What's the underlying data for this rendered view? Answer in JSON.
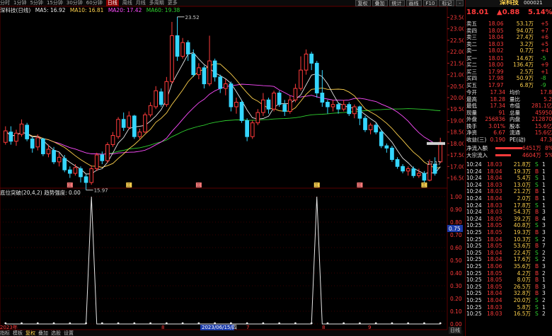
{
  "toolbar": {
    "stock_short": "深科技(日线)",
    "periods": [
      "分时",
      "1分钟",
      "5分钟",
      "15分钟",
      "30分钟",
      "60分钟",
      "日线",
      "周线",
      "月线",
      "多周期",
      "更多"
    ],
    "active_period": "日线",
    "tools": [
      "复权",
      "叠加",
      "统计",
      "画线",
      "F10",
      "标记",
      "-"
    ]
  },
  "ma_legend": {
    "ma5": "MA5: 16.92",
    "ma10": "MA10: 16.81",
    "ma20": "MA20: 17.42",
    "ma60": "MA60: 19.38"
  },
  "indicator_legend": {
    "name": "底位突破(20,4,2)",
    "trend_label": "趋势强度:",
    "trend_value": "0.00"
  },
  "colors": {
    "up": "#ff3b3b",
    "down": "#35d6ff",
    "ma5": "#e8e8e8",
    "ma10": "#ffd24d",
    "ma20": "#ff4dff",
    "ma60": "#2fcf2f"
  },
  "chart_data": {
    "type": "candlestick",
    "y_ticks": [
      "23.50",
      "23.00",
      "22.50",
      "22.00",
      "21.50",
      "21.00",
      "20.50",
      "20.00",
      "19.50",
      "19.00",
      "18.50",
      "18.00",
      "17.50",
      "17.00",
      "16.50"
    ],
    "ylim": [
      16.3,
      23.7
    ],
    "ind_ticks": [
      "1.00",
      "0.90",
      "0.80",
      "0.70",
      "0.60",
      "0.50",
      "0.40",
      "0.30",
      "0.20",
      "0.10",
      "0.00"
    ],
    "ind_ylim": [
      0,
      1.0
    ],
    "high_label": "23.52",
    "low_label": "15.97",
    "last_label": "17.17",
    "marker_value": "0.75",
    "candles": [
      {
        "o": 18.05,
        "c": 18.55,
        "h": 18.75,
        "l": 17.95
      },
      {
        "o": 18.5,
        "c": 18.1,
        "h": 18.75,
        "l": 17.95
      },
      {
        "o": 18.1,
        "c": 18.45,
        "h": 18.6,
        "l": 17.9
      },
      {
        "o": 18.4,
        "c": 18.85,
        "h": 19.05,
        "l": 18.3
      },
      {
        "o": 18.8,
        "c": 18.2,
        "h": 18.9,
        "l": 18.1
      },
      {
        "o": 18.2,
        "c": 17.8,
        "h": 18.3,
        "l": 17.6
      },
      {
        "o": 17.85,
        "c": 18.25,
        "h": 18.4,
        "l": 17.7
      },
      {
        "o": 18.2,
        "c": 17.55,
        "h": 18.25,
        "l": 17.45
      },
      {
        "o": 17.55,
        "c": 17.75,
        "h": 17.95,
        "l": 17.4
      },
      {
        "o": 17.7,
        "c": 17.2,
        "h": 17.85,
        "l": 17.1
      },
      {
        "o": 17.2,
        "c": 17.4,
        "h": 17.6,
        "l": 17.0
      },
      {
        "o": 17.35,
        "c": 16.85,
        "h": 17.5,
        "l": 16.75
      },
      {
        "o": 16.85,
        "c": 16.7,
        "h": 17.0,
        "l": 16.5
      },
      {
        "o": 16.7,
        "c": 16.95,
        "h": 17.1,
        "l": 16.6
      },
      {
        "o": 16.9,
        "c": 16.55,
        "h": 17.0,
        "l": 16.3
      },
      {
        "o": 16.55,
        "c": 16.3,
        "h": 16.65,
        "l": 15.97
      },
      {
        "o": 16.3,
        "c": 16.9,
        "h": 17.05,
        "l": 16.2
      },
      {
        "o": 16.9,
        "c": 17.5,
        "h": 17.6,
        "l": 16.8
      },
      {
        "o": 17.5,
        "c": 17.25,
        "h": 17.65,
        "l": 17.1
      },
      {
        "o": 17.25,
        "c": 17.95,
        "h": 18.05,
        "l": 17.15
      },
      {
        "o": 17.95,
        "c": 18.35,
        "h": 18.5,
        "l": 17.85
      },
      {
        "o": 18.3,
        "c": 19.05,
        "h": 19.15,
        "l": 18.2
      },
      {
        "o": 19.05,
        "c": 18.7,
        "h": 19.35,
        "l": 18.55
      },
      {
        "o": 18.7,
        "c": 19.2,
        "h": 19.4,
        "l": 18.6
      },
      {
        "o": 19.2,
        "c": 18.3,
        "h": 19.25,
        "l": 18.2
      },
      {
        "o": 18.3,
        "c": 18.5,
        "h": 18.65,
        "l": 18.2
      },
      {
        "o": 18.5,
        "c": 19.25,
        "h": 19.35,
        "l": 18.45
      },
      {
        "o": 19.25,
        "c": 19.65,
        "h": 19.8,
        "l": 19.15
      },
      {
        "o": 19.6,
        "c": 20.3,
        "h": 20.5,
        "l": 19.5
      },
      {
        "o": 20.25,
        "c": 19.7,
        "h": 20.4,
        "l": 19.6
      },
      {
        "o": 19.7,
        "c": 20.7,
        "h": 20.9,
        "l": 19.6
      },
      {
        "o": 20.7,
        "c": 22.7,
        "h": 23.3,
        "l": 20.6
      },
      {
        "o": 22.7,
        "c": 21.8,
        "h": 23.52,
        "l": 21.6
      },
      {
        "o": 21.8,
        "c": 22.4,
        "h": 22.6,
        "l": 21.7
      },
      {
        "o": 22.4,
        "c": 21.9,
        "h": 22.5,
        "l": 21.6
      },
      {
        "o": 21.9,
        "c": 21.0,
        "h": 22.1,
        "l": 20.9
      },
      {
        "o": 21.0,
        "c": 21.3,
        "h": 21.5,
        "l": 20.8
      },
      {
        "o": 21.3,
        "c": 20.6,
        "h": 21.4,
        "l": 20.4
      },
      {
        "o": 20.6,
        "c": 21.6,
        "h": 22.7,
        "l": 20.5
      },
      {
        "o": 21.6,
        "c": 20.9,
        "h": 21.7,
        "l": 20.7
      },
      {
        "o": 20.9,
        "c": 20.4,
        "h": 21.0,
        "l": 20.2
      },
      {
        "o": 20.4,
        "c": 20.6,
        "h": 20.8,
        "l": 20.1
      },
      {
        "o": 20.6,
        "c": 19.6,
        "h": 20.7,
        "l": 19.4
      },
      {
        "o": 19.6,
        "c": 19.8,
        "h": 20.0,
        "l": 19.3
      },
      {
        "o": 19.8,
        "c": 19.0,
        "h": 19.9,
        "l": 18.9
      },
      {
        "o": 19.0,
        "c": 18.3,
        "h": 19.1,
        "l": 18.1
      },
      {
        "o": 18.3,
        "c": 18.9,
        "h": 19.0,
        "l": 18.2
      },
      {
        "o": 18.9,
        "c": 19.35,
        "h": 19.5,
        "l": 18.8
      },
      {
        "o": 19.35,
        "c": 19.9,
        "h": 20.2,
        "l": 19.2
      },
      {
        "o": 19.9,
        "c": 19.5,
        "h": 20.0,
        "l": 19.3
      },
      {
        "o": 19.5,
        "c": 20.2,
        "h": 20.3,
        "l": 19.4
      },
      {
        "o": 20.2,
        "c": 19.7,
        "h": 20.3,
        "l": 19.6
      },
      {
        "o": 19.7,
        "c": 19.4,
        "h": 19.9,
        "l": 19.2
      },
      {
        "o": 19.4,
        "c": 19.9,
        "h": 20.1,
        "l": 19.3
      },
      {
        "o": 19.9,
        "c": 20.4,
        "h": 20.6,
        "l": 19.8
      },
      {
        "o": 20.4,
        "c": 21.2,
        "h": 21.8,
        "l": 20.3
      },
      {
        "o": 21.2,
        "c": 21.9,
        "h": 22.1,
        "l": 21.0
      },
      {
        "o": 21.9,
        "c": 21.5,
        "h": 22.0,
        "l": 21.2
      },
      {
        "o": 21.5,
        "c": 20.2,
        "h": 21.6,
        "l": 20.0
      },
      {
        "o": 20.2,
        "c": 19.8,
        "h": 21.2,
        "l": 19.6
      },
      {
        "o": 19.8,
        "c": 19.6,
        "h": 19.9,
        "l": 19.3
      },
      {
        "o": 19.6,
        "c": 19.7,
        "h": 19.9,
        "l": 19.4
      },
      {
        "o": 19.7,
        "c": 19.5,
        "h": 19.8,
        "l": 19.3
      },
      {
        "o": 19.5,
        "c": 19.7,
        "h": 19.9,
        "l": 19.4
      },
      {
        "o": 19.7,
        "c": 19.3,
        "h": 19.8,
        "l": 19.2
      },
      {
        "o": 19.3,
        "c": 19.6,
        "h": 19.7,
        "l": 19.1
      },
      {
        "o": 19.6,
        "c": 19.1,
        "h": 19.65,
        "l": 18.8
      },
      {
        "o": 19.1,
        "c": 18.6,
        "h": 19.2,
        "l": 18.5
      },
      {
        "o": 18.6,
        "c": 18.8,
        "h": 18.9,
        "l": 18.4
      },
      {
        "o": 18.8,
        "c": 18.5,
        "h": 18.9,
        "l": 18.4
      },
      {
        "o": 18.5,
        "c": 17.9,
        "h": 18.6,
        "l": 17.8
      },
      {
        "o": 17.9,
        "c": 17.8,
        "h": 18.0,
        "l": 17.6
      },
      {
        "o": 17.8,
        "c": 17.3,
        "h": 17.9,
        "l": 17.2
      },
      {
        "o": 17.3,
        "c": 17.0,
        "h": 17.4,
        "l": 16.9
      },
      {
        "o": 17.0,
        "c": 16.8,
        "h": 17.1,
        "l": 16.7
      },
      {
        "o": 16.8,
        "c": 16.9,
        "h": 17.0,
        "l": 16.6
      },
      {
        "o": 16.9,
        "c": 16.6,
        "h": 17.0,
        "l": 16.5
      },
      {
        "o": 16.6,
        "c": 16.7,
        "h": 16.9,
        "l": 16.5
      },
      {
        "o": 16.7,
        "c": 16.4,
        "h": 16.8,
        "l": 16.3
      },
      {
        "o": 16.4,
        "c": 17.1,
        "h": 17.3,
        "l": 16.35
      },
      {
        "o": 17.1,
        "c": 16.7,
        "h": 17.4,
        "l": 16.6
      },
      {
        "o": 17.2,
        "c": 18.05,
        "h": 18.25,
        "l": 17.15
      }
    ],
    "ind_values": [
      0,
      0,
      0,
      0,
      0,
      0,
      0,
      0,
      0,
      0,
      0,
      0,
      0,
      0,
      0,
      0,
      1.0,
      0,
      0,
      0,
      0,
      0,
      0,
      0,
      0,
      0,
      0,
      0,
      0,
      0,
      0,
      0,
      0,
      0,
      0,
      0,
      0,
      0,
      0,
      0,
      0,
      0,
      0,
      0,
      0,
      0,
      0,
      0,
      0,
      0,
      0,
      0,
      0,
      0,
      0,
      0,
      0,
      0,
      1.0,
      0,
      0,
      0,
      0,
      0,
      0,
      0,
      0,
      0,
      0,
      0,
      0,
      0,
      0,
      0,
      0,
      0,
      0,
      0,
      0,
      0,
      0,
      0
    ],
    "x_markers": [
      "三",
      "三",
      "三",
      "三",
      "三",
      "三"
    ],
    "date_labels": [
      "2023年",
      "8",
      "2023/06/15/四",
      "7",
      "8",
      "9"
    ]
  },
  "quote": {
    "name": "深科技",
    "code": "000021",
    "price": "18.01",
    "change": "▲0.88",
    "pct": "5.14%",
    "asks": [
      {
        "label": "卖五",
        "price": "18.06",
        "vol": "53.1万",
        "diff": "+5"
      },
      {
        "label": "卖四",
        "price": "18.05",
        "vol": "94.0万",
        "diff": "+7"
      },
      {
        "label": "卖三",
        "price": "18.04",
        "vol": "27.4万",
        "diff": "+6"
      },
      {
        "label": "卖二",
        "price": "18.03",
        "vol": "3.2万",
        "diff": "+5"
      },
      {
        "label": "卖一",
        "price": "18.02",
        "vol": "0.7万",
        "diff": "+4"
      }
    ],
    "bids": [
      {
        "label": "买一",
        "price": "18.01",
        "vol": "14.6万",
        "diff": "-5"
      },
      {
        "label": "买二",
        "price": "18.00",
        "vol": "136.4万",
        "diff": "+9"
      },
      {
        "label": "买三",
        "price": "17.99",
        "vol": "2.5万",
        "diff": "+1"
      },
      {
        "label": "买四",
        "price": "17.98",
        "vol": "50.9万",
        "diff": "-8"
      },
      {
        "label": "买五",
        "price": "17.97",
        "vol": "6.8万",
        "diff": "-9"
      }
    ],
    "stats": [
      {
        "k1": "今开",
        "v1": "17.34",
        "k2": "均价",
        "v2": "17.8"
      },
      {
        "k1": "最高",
        "v1": "18.28",
        "k2": "量比",
        "v2": "5.2"
      },
      {
        "k1": "最低",
        "v1": "17.34",
        "k2": "市值",
        "v2": "281.1亿"
      },
      {
        "k1": "现量",
        "v1": "91",
        "k2": "总量",
        "v2": "45950"
      },
      {
        "k1": "外盘",
        "v1": "256836",
        "k2": "内盘",
        "v2": "212870"
      },
      {
        "k1": "换手",
        "v1": "3.01%",
        "k2": "股本",
        "v2": "15.6亿"
      },
      {
        "k1": "净资",
        "v1": "6.67",
        "k2": "流通",
        "v2": "15.6亿"
      },
      {
        "k1": "收益(三)",
        "v1": "0.190",
        "k2": "PE(动)",
        "v2": "47.3"
      }
    ],
    "flows": [
      {
        "label": "净流入额",
        "value": "6451万",
        "pct": "8%"
      },
      {
        "label": "大宗流入",
        "value": "4604万",
        "pct": "5%"
      }
    ],
    "ticks": [
      {
        "t": "10:24",
        "p": "18.03",
        "v": "21.8万",
        "s": "S",
        "n": "1"
      },
      {
        "t": "10:24",
        "p": "18.04",
        "v": "19.3万",
        "s": "B",
        "n": "1"
      },
      {
        "t": "10:24",
        "p": "18.04",
        "v": "5.4万",
        "s": "S",
        "n": "1"
      },
      {
        "t": "10:24",
        "p": "18.03",
        "v": "13.0万",
        "s": "S",
        "n": "1"
      },
      {
        "t": "10:24",
        "p": "18.03",
        "v": "21.2万",
        "s": "B",
        "n": "1"
      },
      {
        "t": "10:24",
        "p": "18.04",
        "v": "2.0万",
        "s": "B",
        "n": "1"
      },
      {
        "t": "10:24",
        "p": "18.03",
        "v": "17.8万",
        "s": "S",
        "n": "1"
      },
      {
        "t": "10:24",
        "p": "18.03",
        "v": "54.3万",
        "s": "B",
        "n": "3"
      },
      {
        "t": "10:24",
        "p": "18.05",
        "v": "39.2万",
        "s": "B",
        "n": "4"
      },
      {
        "t": "10:25",
        "p": "18.05",
        "v": "40.8万",
        "s": "S",
        "n": "3"
      },
      {
        "t": "10:25",
        "p": "18.05",
        "v": "19.3万",
        "s": "B",
        "n": "3"
      },
      {
        "t": "10:25",
        "p": "18.04",
        "v": "10.3万",
        "s": "S",
        "n": "2"
      },
      {
        "t": "10:25",
        "p": "18.05",
        "v": "53.6万",
        "s": "B",
        "n": "7"
      },
      {
        "t": "10:25",
        "p": "18.04",
        "v": "22.4万",
        "s": "S",
        "n": "2"
      },
      {
        "t": "10:25",
        "p": "18.04",
        "v": "17.6万",
        "s": "S",
        "n": "2"
      },
      {
        "t": "10:25",
        "p": "18.06",
        "v": "35.6万",
        "s": "B",
        "n": "3"
      },
      {
        "t": "10:25",
        "p": "18.05",
        "v": "4.2万",
        "s": "B",
        "n": "2"
      },
      {
        "t": "10:25",
        "p": "18.05",
        "v": "8.0万",
        "s": "B",
        "n": "1"
      },
      {
        "t": "10:25",
        "p": "18.05",
        "v": "26.5万",
        "s": "B",
        "n": "3"
      },
      {
        "t": "10:25",
        "p": "18.04",
        "v": "32.8万",
        "s": "B",
        "n": "3"
      },
      {
        "t": "10:25",
        "p": "18.04",
        "v": "20.0万",
        "s": "S",
        "n": "2"
      },
      {
        "t": "10:25",
        "p": "18.03",
        "v": "5.8万",
        "s": "S",
        "n": "1"
      },
      {
        "t": "10:25",
        "p": "18.03",
        "v": "16.5万",
        "s": "S",
        "n": "2"
      }
    ]
  },
  "bottombar": {
    "items": [
      "指标",
      "模板",
      "复权",
      "叠加",
      "选股",
      "设置"
    ],
    "active": "复权",
    "right_label": "日线"
  }
}
